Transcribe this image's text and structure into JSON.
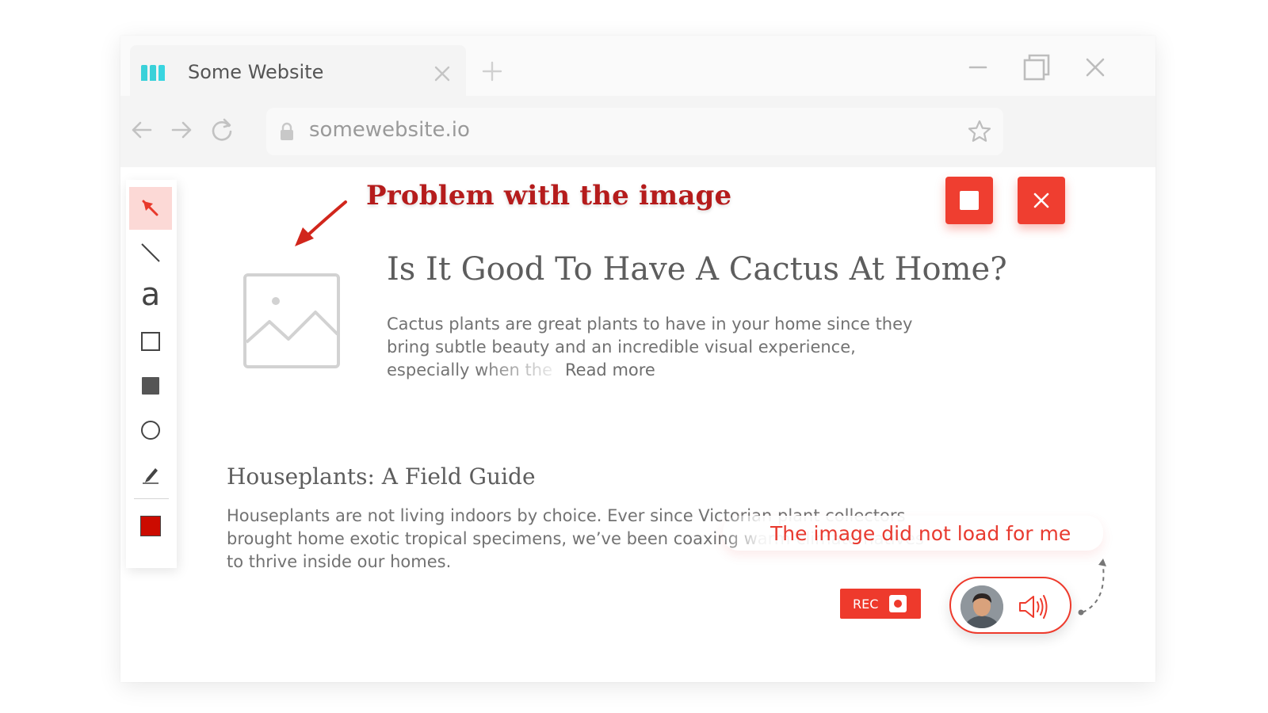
{
  "browser": {
    "tab_title": "Some Website",
    "url": "somewebsite.io"
  },
  "toolbar": {
    "tools": [
      "pointer-tool",
      "line-tool",
      "text-tool",
      "rectangle-tool",
      "filled-rectangle-tool",
      "circle-tool",
      "pen-tool",
      "color-swatch"
    ],
    "text_tool_glyph": "a",
    "selected_color": "#cc0b00"
  },
  "annotation": {
    "title": "Problem with the image",
    "comment": "The image did not load for me",
    "color": "#b51c1c"
  },
  "article": {
    "title": "Is It Good To Have A Cactus At Home?",
    "body_lines": [
      "Cactus plants are great plants to have in your home since they",
      "bring subtle beauty and an incredible visual experience,"
    ],
    "body_faded": "especially when the",
    "read_more": "Read more"
  },
  "section": {
    "title": "Houseplants: A Field Guide",
    "body": "Houseplants are not living indoors by choice. Ever since Victorian plant collectors brought home exotic tropical specimens, we’ve been coaxing warm-climate natives to thrive inside our homes."
  },
  "recording": {
    "rec_label": "REC",
    "accent": "#ee3a2c"
  }
}
